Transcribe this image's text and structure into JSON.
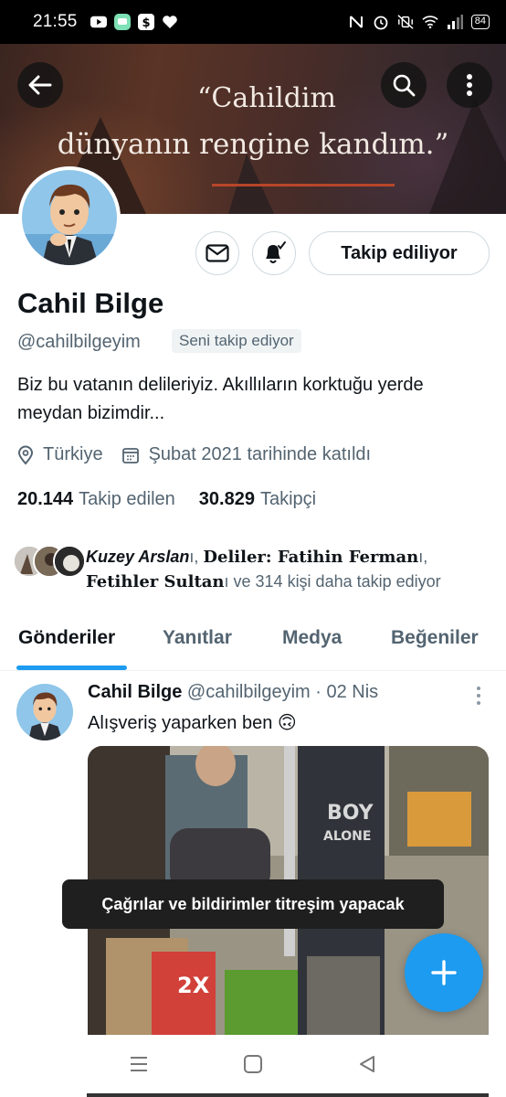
{
  "status_bar": {
    "time": "21:55",
    "battery": "84",
    "icons_left": [
      "youtube-icon",
      "chat-app-icon",
      "dollar-app-icon",
      "heart-icon"
    ],
    "icons_right": [
      "nfc-icon",
      "alarm-icon",
      "vibrate-icon",
      "wifi-icon",
      "signal-icon",
      "battery-icon"
    ]
  },
  "banner": {
    "line1": "“Cahildim",
    "line2": "dünyanın rengine kandım.”"
  },
  "profile": {
    "name": "Cahil Bilge",
    "handle": "@cahilbilgeyim",
    "follows_you": "Seni takip ediyor",
    "bio": "Biz bu vatanın delileriyiz. Akıllıların korktuğu yerde meydan bizimdir...",
    "location": "Türkiye",
    "joined": "Şubat 2021 tarihinde katıldı",
    "following_count": "20.144",
    "following_label": "Takip edilen",
    "followers_count": "30.829",
    "followers_label": "Takipçi",
    "follow_button": "Takip ediliyor"
  },
  "followed_by": {
    "name1": "Kuzey Arslan",
    "name1_suffix": "ı, ",
    "name2": "Deliler: Fatihin Ferman",
    "name2_suffix": "ı, ",
    "name3": "Fetihler Sultan",
    "rest": "ı ve 314 kişi daha takip ediyor"
  },
  "tabs": [
    "Gönderiler",
    "Yanıtlar",
    "Medya",
    "Beğeniler"
  ],
  "post": {
    "author": "Cahil Bilge",
    "handle_date": "@cahilbilgeyim · 02 Nis",
    "text": "Alışveriş yaparken ben 🙃",
    "image_text1": "BOY",
    "image_text2": "ALONE",
    "box_text": "2X"
  },
  "toast": "Çağrılar ve bildirimler titreşim yapacak",
  "colors": {
    "accent": "#1d9bf0",
    "text_secondary": "#536471"
  }
}
